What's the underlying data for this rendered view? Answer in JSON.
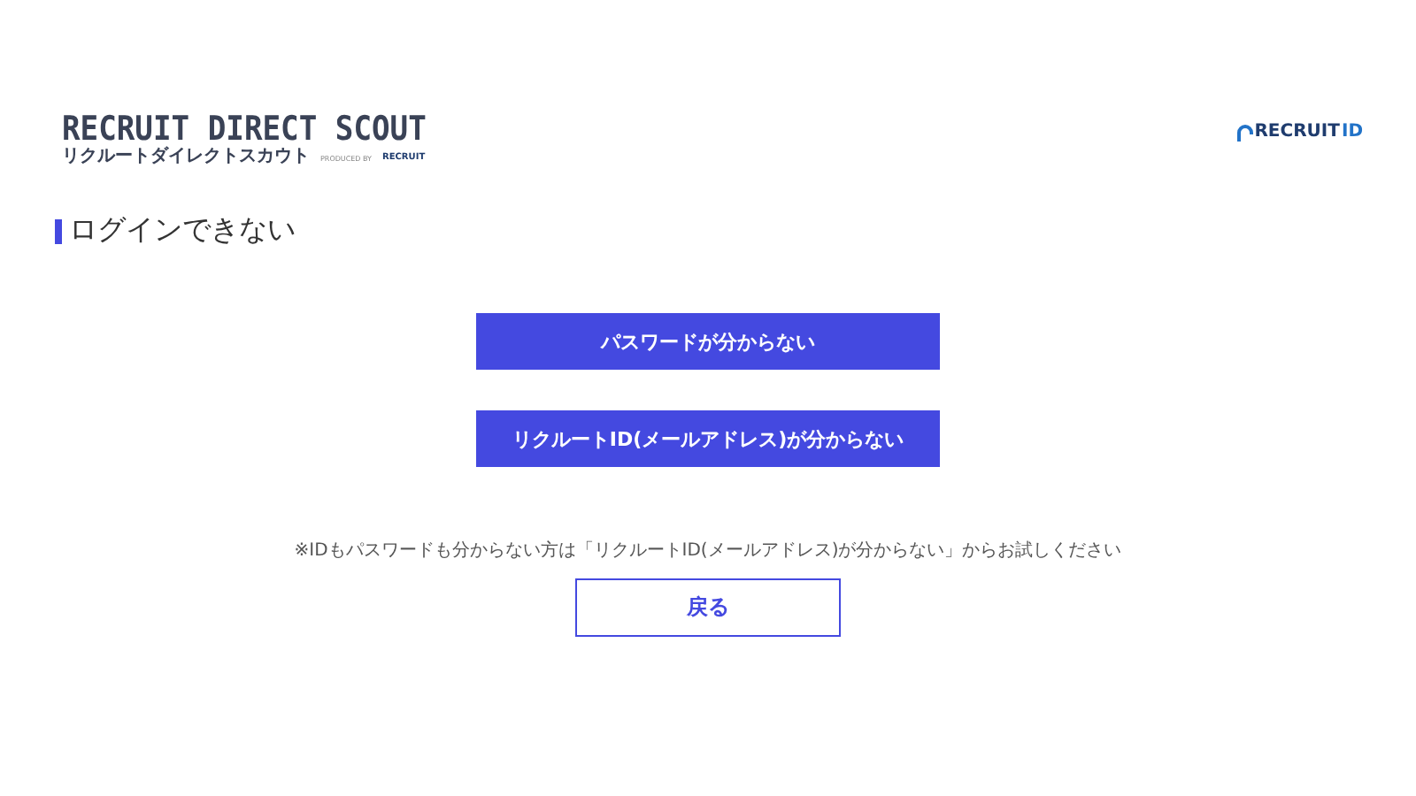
{
  "header": {
    "logo_title": "RECRUIT DIRECT SCOUT",
    "logo_subtitle": "リクルートダイレクトスカウト",
    "produced_by": "PRODUCED BY",
    "produced_brand": "RECRUIT",
    "id_logo_brand": "RECRUIT",
    "id_logo_suffix": "ID"
  },
  "page_title": "ログインできない",
  "options": [
    {
      "label": "パスワードが分からない"
    },
    {
      "label": "リクルートID(メールアドレス)が分からない"
    }
  ],
  "note": "※IDもパスワードも分からない方は「リクルートID(メールアドレス)が分からない」からお試しください",
  "back_button": "戻る"
}
